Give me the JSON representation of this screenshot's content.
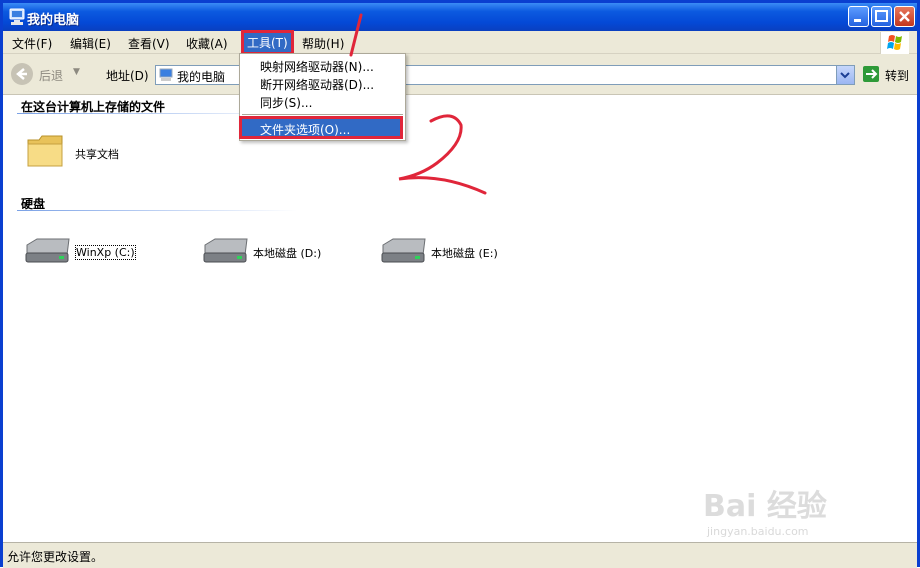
{
  "window": {
    "title": "我的电脑"
  },
  "menubar": {
    "items": [
      {
        "label": "文件(F)"
      },
      {
        "label": "编辑(E)"
      },
      {
        "label": "查看(V)"
      },
      {
        "label": "收藏(A)"
      },
      {
        "label": "工具(T)",
        "active": true
      },
      {
        "label": "帮助(H)"
      }
    ]
  },
  "tools_menu": {
    "items": [
      {
        "label": "映射网络驱动器(N)..."
      },
      {
        "label": "断开网络驱动器(D)..."
      },
      {
        "label": "同步(S)..."
      },
      {
        "label": "文件夹选项(O)...",
        "highlighted": true
      }
    ]
  },
  "toolbar": {
    "back_label": "后退",
    "address_label": "地址(D)",
    "address_value": "我的电脑",
    "go_label": "转到"
  },
  "sections": [
    {
      "title": "在这台计算机上存储的文件",
      "items": [
        {
          "label": "共享文档",
          "icon": "folder-icon"
        }
      ]
    },
    {
      "title": "硬盘",
      "items": [
        {
          "label": "WinXp (C:)",
          "icon": "hard-drive-icon"
        },
        {
          "label": "本地磁盘 (D:)",
          "icon": "hard-drive-icon"
        },
        {
          "label": "本地磁盘 (E:)",
          "icon": "hard-drive-icon"
        }
      ]
    }
  ],
  "status_bar": {
    "text": "允许您更改设置。"
  },
  "annotations": {
    "mark_1": "1",
    "mark_2": "2"
  },
  "watermark": {
    "text": "Bai 经验",
    "url": "jingyan.baidu.com"
  },
  "colors": {
    "titlebar": "#0449d6",
    "highlight": "#316ac5",
    "annotation": "#e0263a"
  }
}
